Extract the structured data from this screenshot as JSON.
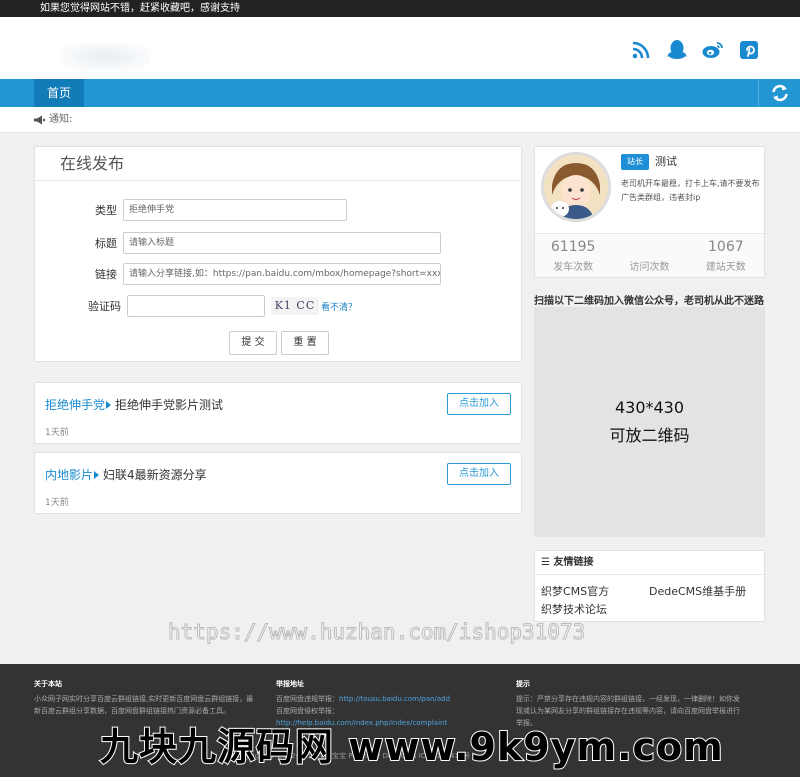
{
  "topbar": {
    "text": "如果您觉得网站不错，赶紧收藏吧，感谢支持"
  },
  "header": {
    "social_icons": [
      "rss-icon",
      "qq-icon",
      "weibo-icon",
      "pinterest-icon"
    ]
  },
  "nav": {
    "home_label": "首页"
  },
  "notice": {
    "label": "通知:"
  },
  "form": {
    "title": "在线发布",
    "type_label": "类型",
    "type_value": "拒绝伸手党",
    "title_label": "标题",
    "title_placeholder": "请输入标题",
    "link_label": "链接",
    "link_placeholder": "请输入分享链接,如：https://pan.baidu.com/mbox/homepage?short=xxxxxxx",
    "captcha_label": "验证码",
    "captcha_text": "K1 CC",
    "captcha_refresh": "看不清？",
    "submit_label": "提 交",
    "reset_label": "重 置"
  },
  "items": [
    {
      "category": "拒绝伸手党",
      "name": "拒绝伸手党影片测试",
      "time": "1天前",
      "join_label": "点击加入"
    },
    {
      "category": "内地影片",
      "name": "妇联4最新资源分享",
      "time": "1天前",
      "join_label": "点击加入"
    }
  ],
  "profile": {
    "badge": "站长",
    "name": "测试",
    "bio": "老司机开车最稳，打卡上车,请不要发布广告类群组，违者封ip",
    "stats": [
      {
        "value": "61195",
        "label": "发车次数"
      },
      {
        "value": "",
        "label": "访问次数"
      },
      {
        "value": "1067",
        "label": "建站天数"
      }
    ]
  },
  "qr": {
    "caption": "扫描以下二维码加入微信公众号，老司机从此不迷路",
    "size_text": "430*430",
    "desc": "可放二维码"
  },
  "links": {
    "title": "友情链接",
    "items": [
      "织梦CMS官方",
      "DedeCMS维基手册",
      "织梦技术论坛"
    ]
  },
  "watermark_url": "https://www.huzhan.com/ishop31073",
  "footer": {
    "about_title": "关于本站",
    "about_text": "小众网子网实时分享百度云群组链接,实时更新百度网盘云群组链接，最新百度云群组分享数据，百度网盘群组链接热门资源必备工具。",
    "report_title": "举报地址",
    "report_line1_label": "百度网盘违规举报：",
    "report_line1_link": "http://tousu.baidu.com/pan/add",
    "report_line2_label": "百度网盘侵权举报：",
    "report_line2_link": "http://help.baidu.com/index.php/index/complaint",
    "tips_title": "提示",
    "tips_text": "提示：严禁分享存在违规内容的群组链接，一经发现，一律删除！如你发现或认为某网友分享的群组链接存在违规等内容，请向百度网盘举报进行举报。",
    "copyright": "Copyright © 2002-2019 宝宝宝宝 Power by DedeCms  ICP备102419号"
  },
  "watermark_big": "九块九源码网  www.9k9ym.com"
}
